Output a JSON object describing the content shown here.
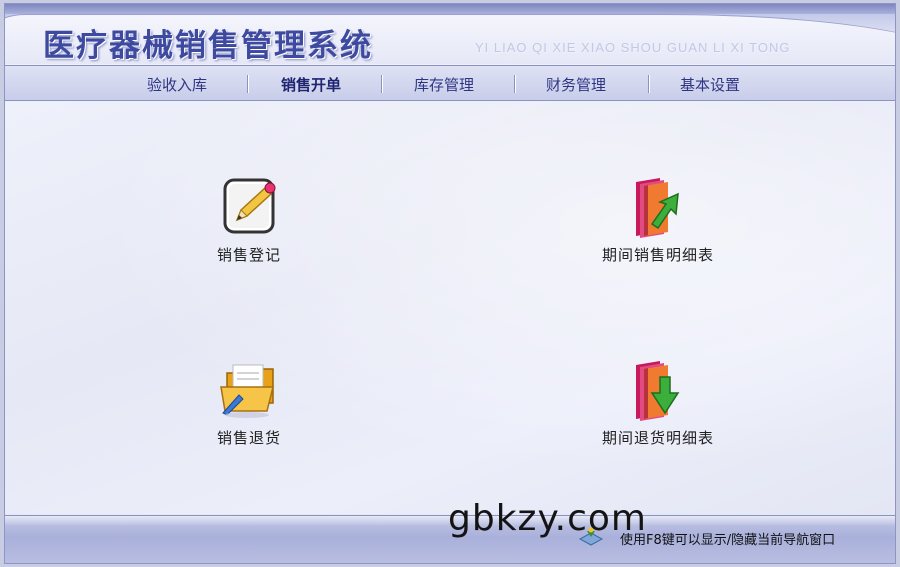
{
  "header": {
    "title": "医疗器械销售管理系统",
    "subtitle": "YI LIAO QI XIE XIAO SHOU GUAN LI XI TONG"
  },
  "nav": {
    "items": [
      {
        "label": "验收入库"
      },
      {
        "label": "销售开单",
        "active": true
      },
      {
        "label": "库存管理"
      },
      {
        "label": "财务管理"
      },
      {
        "label": "基本设置"
      }
    ]
  },
  "tiles": [
    {
      "label": "销售登记",
      "icon": "edit-pencil-icon"
    },
    {
      "label": "期间销售明细表",
      "icon": "book-arrow-up-icon"
    },
    {
      "label": "销售退货",
      "icon": "folder-pen-icon"
    },
    {
      "label": "期间退货明细表",
      "icon": "book-arrow-down-icon"
    }
  ],
  "footer": {
    "watermark": "gbkzy.com",
    "hint": "使用F8键可以显示/隐藏当前导航窗口",
    "hint_icon": "navigation-toggle-icon"
  },
  "colors": {
    "title": "#3e4aa0",
    "nav_text": "#2f3585",
    "background": "#e9ebf7",
    "footer_bar": "#a9b0da"
  }
}
